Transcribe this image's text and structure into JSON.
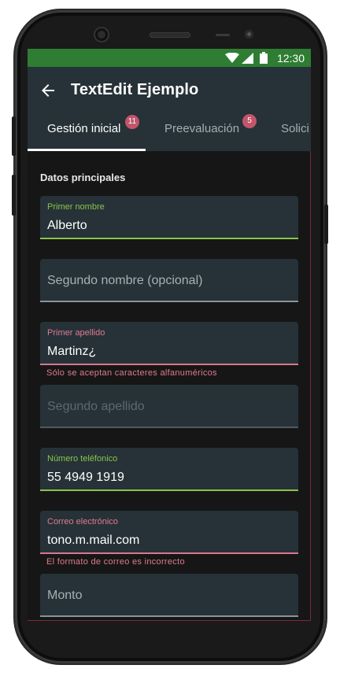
{
  "status_bar": {
    "time": "12:30",
    "icons": [
      "wifi-icon",
      "signal-icon",
      "battery-icon"
    ]
  },
  "app_bar": {
    "title": "TextEdit Ejemplo",
    "back_icon": "arrow-left-icon"
  },
  "tabs": [
    {
      "label": "Gestión inicial",
      "badge": "11",
      "active": true
    },
    {
      "label": "Preevaluación",
      "badge": "5",
      "active": false
    },
    {
      "label": "Solici",
      "badge": "",
      "active": false
    }
  ],
  "section_title": "Datos principales",
  "fields": [
    {
      "label": "Primer nombre",
      "value": "Alberto",
      "state": "focused-valid"
    },
    {
      "placeholder": "Segundo nombre (opcional)",
      "state": "empty"
    },
    {
      "label": "Primer apellido",
      "value": "Martinz¿",
      "state": "error",
      "helper": "Sólo se aceptan caracteres alfanuméricos"
    },
    {
      "placeholder": "Segundo apellido",
      "state": "disabled"
    },
    {
      "label": "Número teléfonico",
      "value": "55 4949 1919",
      "state": "focused-valid"
    },
    {
      "label": "Correo electrónico",
      "value": "tono.m.mail.com",
      "state": "error",
      "helper": "El formato de correo es incorrecto"
    },
    {
      "placeholder": "Monto",
      "state": "empty"
    }
  ],
  "colors": {
    "status_bar": "#2e7d32",
    "app_bar": "#263238",
    "valid": "#8bc34a",
    "error": "#e07a90",
    "badge": "#c2556a"
  }
}
